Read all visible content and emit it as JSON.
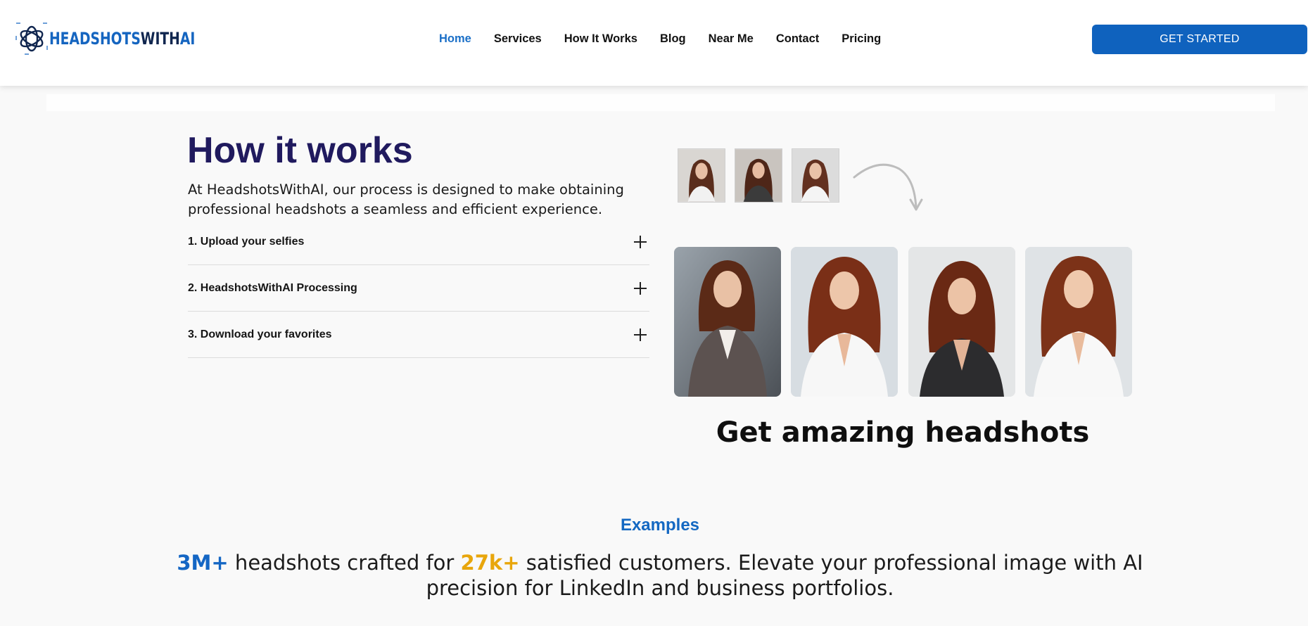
{
  "brand": {
    "name_part1": "HEADSHOTS",
    "name_part2": "WITH",
    "name_part3": "AI",
    "logo_icon": "openai-knot-icon"
  },
  "nav": {
    "items": [
      {
        "label": "Home",
        "active": true
      },
      {
        "label": "Services"
      },
      {
        "label": "How It Works"
      },
      {
        "label": "Blog"
      },
      {
        "label": "Near Me"
      },
      {
        "label": "Contact"
      },
      {
        "label": "Pricing"
      }
    ],
    "cta_label": "GET STARTED",
    "accent": "#0f62be"
  },
  "how": {
    "title": "How it works",
    "intro": "At HeadshotsWithAI, our process is designed to make obtaining professional headshots a seamless and efficient experience.",
    "steps": [
      {
        "label": "1. Upload your selfies",
        "icon": "plus-icon"
      },
      {
        "label": "2. HeadshotsWithAI Processing",
        "icon": "plus-icon"
      },
      {
        "label": "3. Download your favorites",
        "icon": "plus-icon"
      }
    ],
    "image_caption": "Get amazing headshots"
  },
  "examples": {
    "title": "Examples",
    "stat1": "3M+",
    "text1": " headshots crafted for ",
    "stat2": "27k+",
    "text2": "  satisfied customers. Elevate your professional image with AI precision for LinkedIn and business portfolios.",
    "colors": {
      "stat1": "#1466c4",
      "stat2": "#e8a60c"
    }
  }
}
